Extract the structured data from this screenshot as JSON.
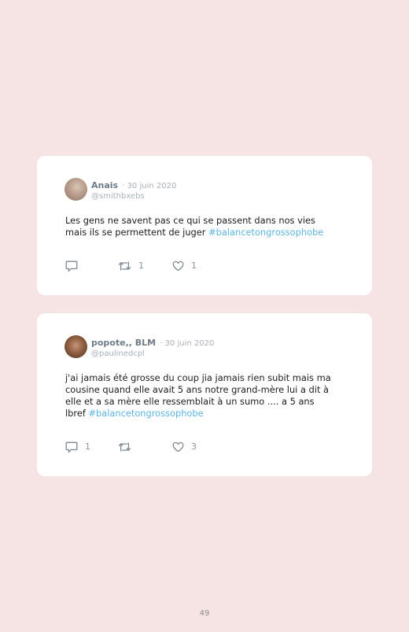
{
  "tweets": [
    {
      "name": "Anais",
      "date": "· 30 juin 2020",
      "handle": "@smithbxebs",
      "text_lines": [
        "Les gens ne savent pas ce qui se passent dans nos vies",
        "mais ils se permettent de juger "
      ],
      "hashtag": "#balancetongrossophobe",
      "replies": "",
      "retweets": "1",
      "likes": "1"
    },
    {
      "name": "popote,, BLM",
      "date": "· 30 juin 2020",
      "handle": "@paulinedcpl",
      "text_lines": [
        "j'ai jamais été grosse du coup jia jamais rien subit mais ma",
        "cousine quand elle avait 5 ans notre grand-mère lui a dit à",
        "elle et a sa mère elle ressemblait à un sumo .... a 5 ans",
        "lbref "
      ],
      "hashtag": "#balancetongrossophobe",
      "replies": "1",
      "retweets": "",
      "likes": "3"
    }
  ],
  "icons": {
    "reply": "reply-icon",
    "retweet": "retweet-icon",
    "like": "heart-icon"
  },
  "page_number": "49",
  "colors": {
    "background": "#f6e3e4",
    "card": "#ffffff",
    "hashtag": "#5bb5e3",
    "name": "#6f7c88",
    "meta": "#a9b1b9"
  }
}
